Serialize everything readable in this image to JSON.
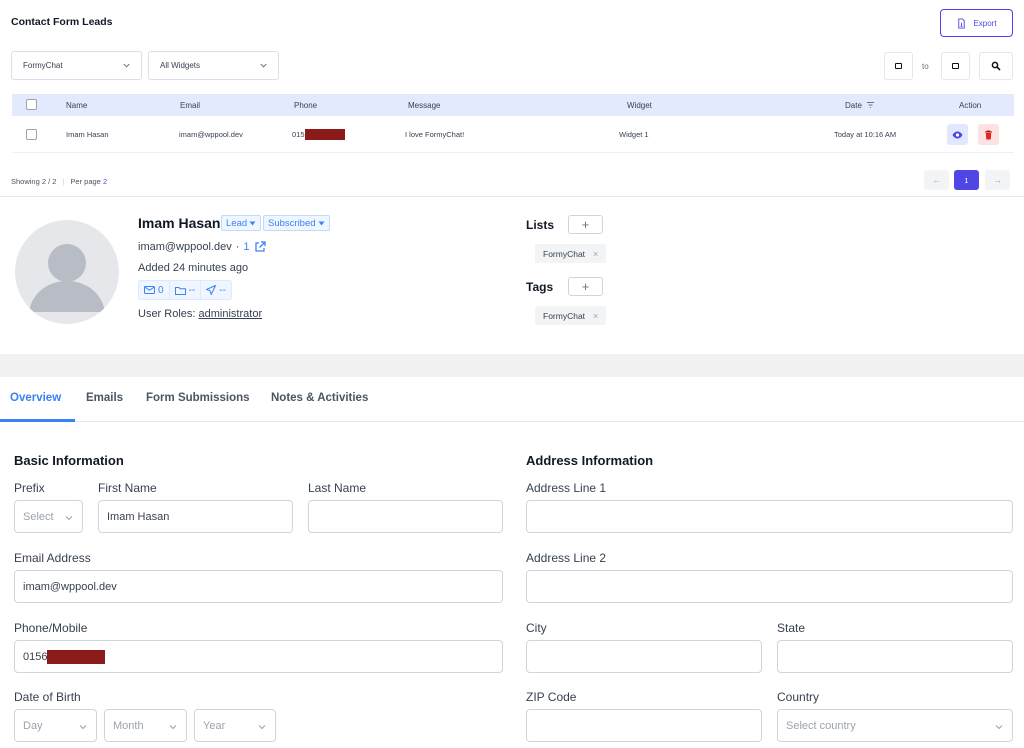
{
  "header": {
    "title": "Contact Form Leads",
    "export_label": "Export"
  },
  "filters": {
    "source": "FormyChat",
    "widgets": "All Widgets",
    "date_to": "to"
  },
  "table": {
    "columns": [
      "Name",
      "Email",
      "Phone",
      "Message",
      "Widget",
      "Date",
      "Action"
    ],
    "rows": [
      {
        "name": "Imam Hasan",
        "email": "imam@wppool.dev",
        "phone": "015",
        "message": "I love FormyChat!",
        "widget": "Widget 1",
        "date": "Today at 10:16 AM"
      }
    ]
  },
  "pagination": {
    "showing": "Showing 2 / 2",
    "per_page_label": "Per page",
    "per_page_value": "2",
    "current_page": "1",
    "prev": "←",
    "next": "→"
  },
  "contact": {
    "name": "Imam Hasan",
    "lead_badge": "Lead",
    "subscribed_badge": "Subscribed",
    "email": "imam@wppool.dev",
    "dot": "·",
    "link_count": "1",
    "added": "Added 24 minutes ago",
    "stat_emails": "0",
    "stat_folders": "--",
    "stat_sent": "--",
    "roles_label": "User Roles:",
    "roles_value": "administrator",
    "lists_label": "Lists",
    "list_chip": "FormyChat",
    "tags_label": "Tags",
    "tag_chip": "FormyChat",
    "chip_remove": "×",
    "add": "+"
  },
  "tabs": [
    "Overview",
    "Emails",
    "Form Submissions",
    "Notes & Activities"
  ],
  "basic": {
    "title": "Basic Information",
    "prefix_label": "Prefix",
    "prefix_placeholder": "Select",
    "first_name_label": "First Name",
    "first_name_value": "Imam Hasan",
    "last_name_label": "Last Name",
    "last_name_value": "",
    "email_label": "Email Address",
    "email_value": "imam@wppool.dev",
    "phone_label": "Phone/Mobile",
    "phone_value": "0156",
    "dob_label": "Date of Birth",
    "dob_day": "Day",
    "dob_month": "Month",
    "dob_year": "Year"
  },
  "address": {
    "title": "Address Information",
    "line1_label": "Address Line 1",
    "line2_label": "Address Line 2",
    "city_label": "City",
    "state_label": "State",
    "zip_label": "ZIP Code",
    "country_label": "Country",
    "country_placeholder": "Select country"
  },
  "colors": {
    "accent": "#4f46e5",
    "tab_active": "#3b82f6",
    "table_header": "#e3eafe",
    "redaction": "#8b1a1a"
  },
  "icons": [
    "export-icon",
    "chevron-down-icon",
    "calendar-icon",
    "search-icon",
    "eye-icon",
    "trash-icon",
    "external-link-icon",
    "mail-icon",
    "folder-icon",
    "send-icon",
    "user-avatar-icon"
  ]
}
